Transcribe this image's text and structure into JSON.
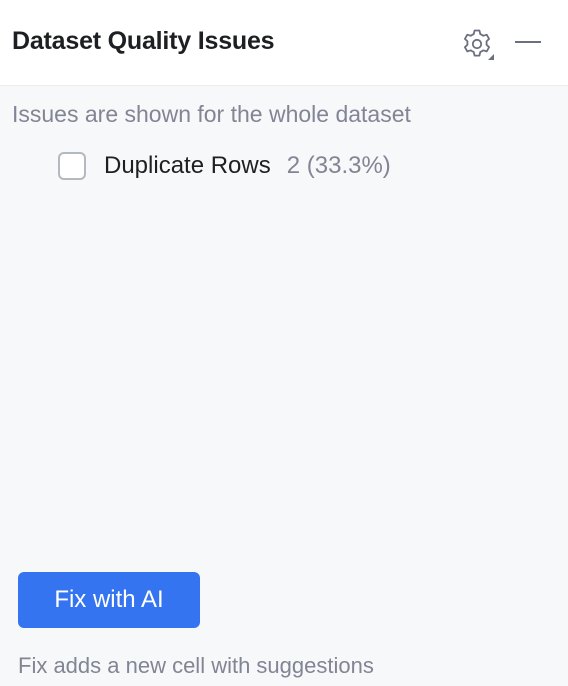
{
  "header": {
    "title": "Dataset Quality Issues",
    "settings_icon": "gear-icon",
    "minimize_icon": "minimize-icon"
  },
  "info_text": "Issues are shown for the whole dataset",
  "issues": [
    {
      "label": "Duplicate Rows",
      "count": "2 (33.3%)",
      "checked": false
    }
  ],
  "actions": {
    "fix_button_label": "Fix with AI",
    "fix_note": "Fix adds a new cell with suggestions"
  },
  "colors": {
    "accent": "#3574f0",
    "muted_text": "#818594",
    "header_bg": "#ffffff",
    "panel_bg": "#f7f8fa"
  }
}
